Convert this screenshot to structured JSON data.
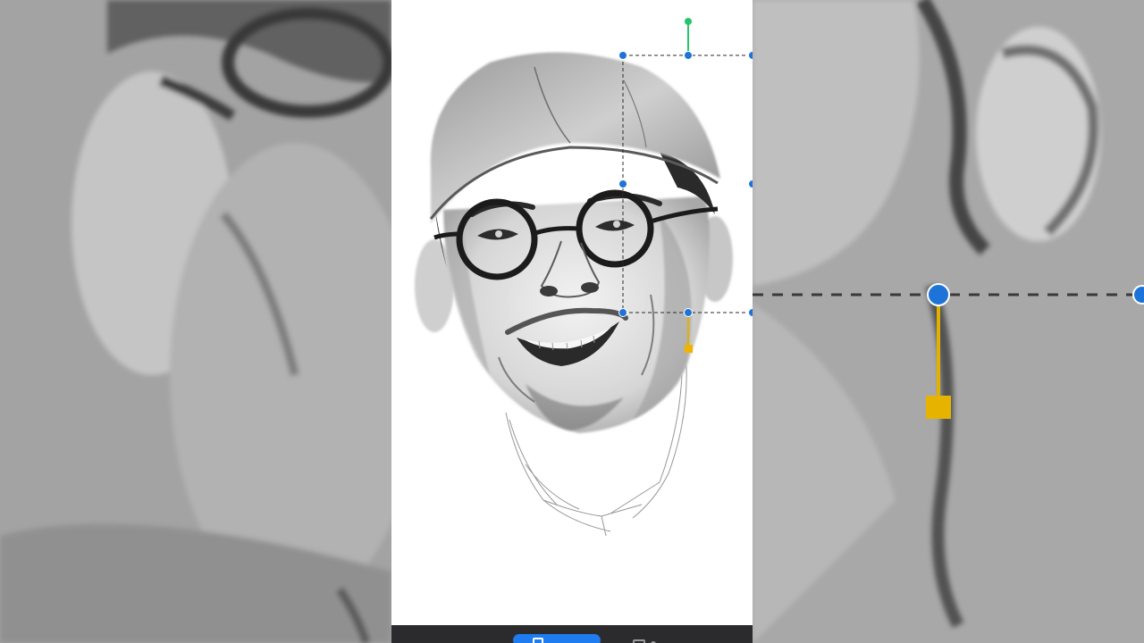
{
  "app": {
    "artwork_subject": "portrait-sketch"
  },
  "colors": {
    "selection_handle": "#1e73d8",
    "rotate_handle": "#29c46a",
    "anchor_handle": "#f0b400",
    "toolbar_bg": "#2b2b2d",
    "active_tool": "#1e7bf0"
  },
  "icons": {
    "active_tool_icon": "layer-square-icon",
    "secondary_tool_icon": "square-outline-icon"
  },
  "toolbar": {
    "active_tool_label": "",
    "secondary_tool_label": ""
  }
}
